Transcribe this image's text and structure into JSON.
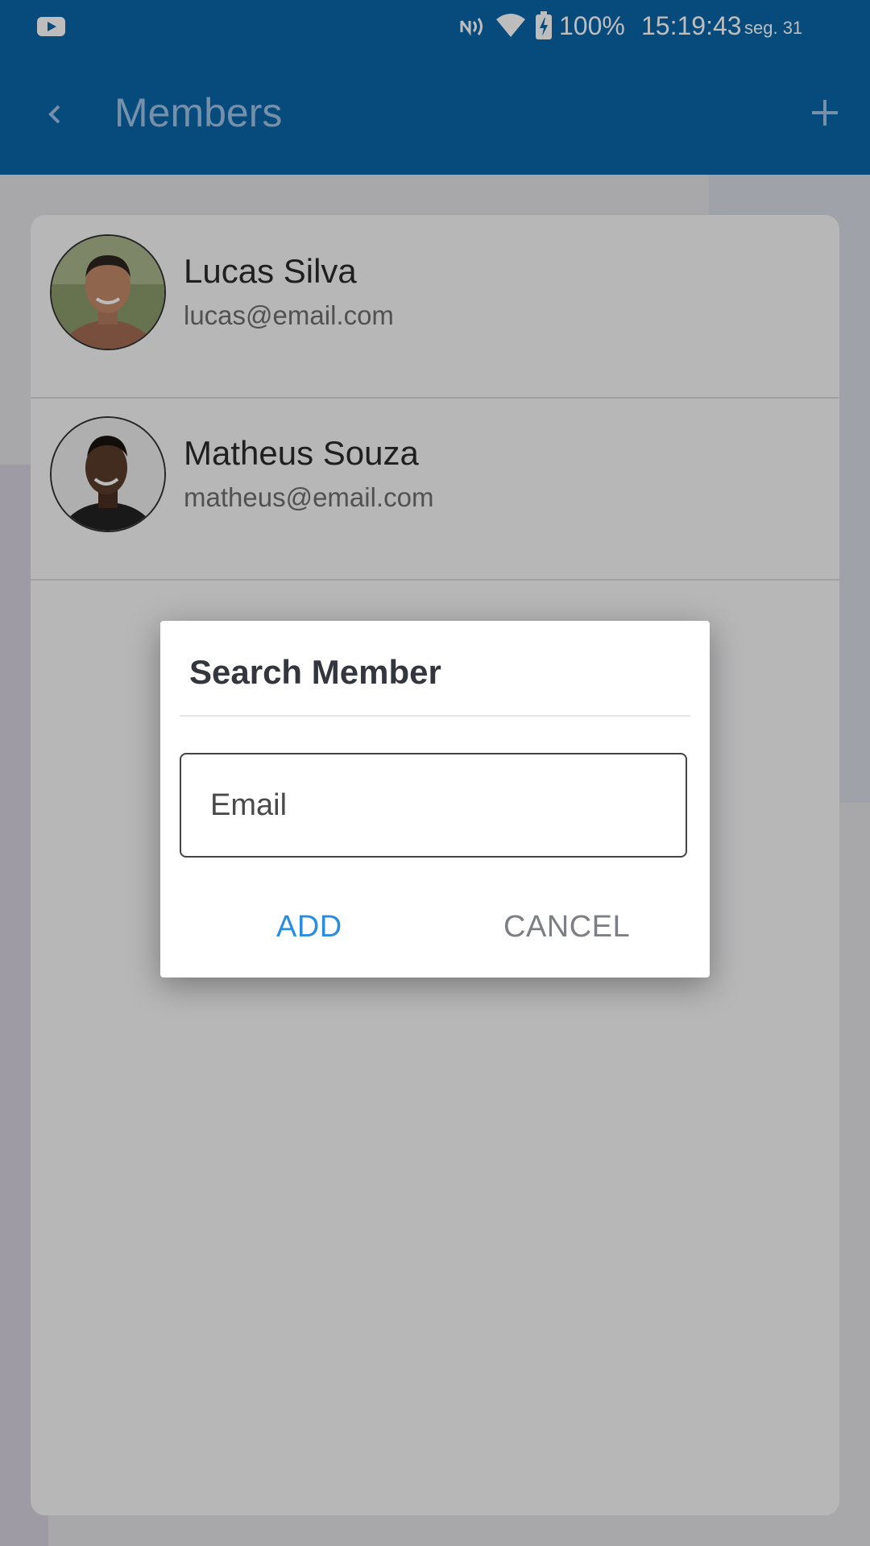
{
  "status_bar": {
    "battery": "100%",
    "time": "15:19:43",
    "date": "seg. 31",
    "icons": [
      "youtube-icon",
      "nfc-icon",
      "wifi-icon",
      "battery-charging-icon"
    ]
  },
  "app_bar": {
    "title": "Members",
    "back_icon": "chevron-left-icon",
    "add_icon": "plus-icon"
  },
  "members": [
    {
      "name": "Lucas Silva",
      "email": "lucas@email.com"
    },
    {
      "name": "Matheus Souza",
      "email": "matheus@email.com"
    }
  ],
  "dialog": {
    "title": "Search Member",
    "email_placeholder": "Email",
    "email_value": "",
    "add_label": "ADD",
    "cancel_label": "CANCEL"
  },
  "colors": {
    "primary": "#0a64a8",
    "accent": "#2a8de0"
  }
}
